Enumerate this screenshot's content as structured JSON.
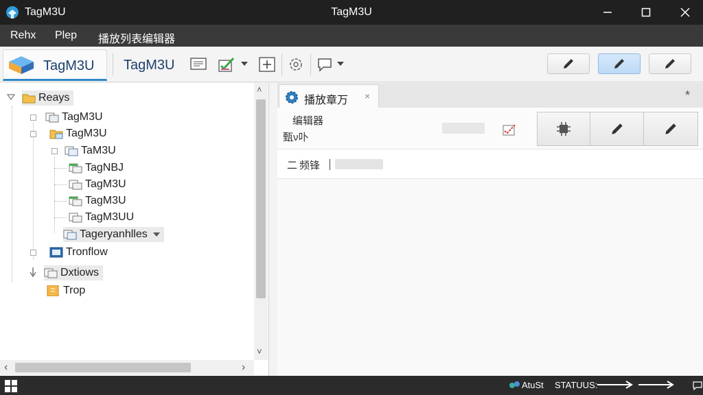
{
  "window": {
    "app_name": "TagM3U",
    "center_title": "TagM3U",
    "controls": {
      "minimize": "—",
      "maximize": "☐",
      "close": "✕"
    }
  },
  "menu": {
    "items": [
      "Rehx",
      "Plep",
      "播放列表编辑器"
    ]
  },
  "toolbar": {
    "brand_label": "TagM3U",
    "title_label": "TagM3U",
    "icons": [
      "list-icon",
      "checklist-icon",
      "add-icon",
      "settings-icon",
      "comment-icon",
      "pencil-icon"
    ]
  },
  "tree": {
    "root": "Reays",
    "nodes": [
      "TagM3U",
      "TagM3U",
      "TaM3U",
      "TagNBJ",
      "TagM3U",
      "TagM3U",
      "TagM3UU",
      "Tagerуanhlles",
      "Tronflow",
      "Dxtiows",
      "Trop"
    ]
  },
  "editor": {
    "tab_label": "播放章万",
    "tab_close": "×",
    "pin": "*",
    "props_label1": "编辑器",
    "props_label2": "甄ν卟",
    "row_number": "二",
    "row_key": "频锋"
  },
  "scroll": {
    "up": "˄",
    "down": "˅",
    "left": "‹",
    "right": "›"
  },
  "statusbar": {
    "item1": "AtuSt",
    "item2": "STATUUS:"
  },
  "colors": {
    "accent": "#2f86c8",
    "titlebar": "#202020",
    "menubar": "#3a3a3a",
    "taskbar": "#2b2b2b",
    "brand_text": "#1c3f6e"
  }
}
